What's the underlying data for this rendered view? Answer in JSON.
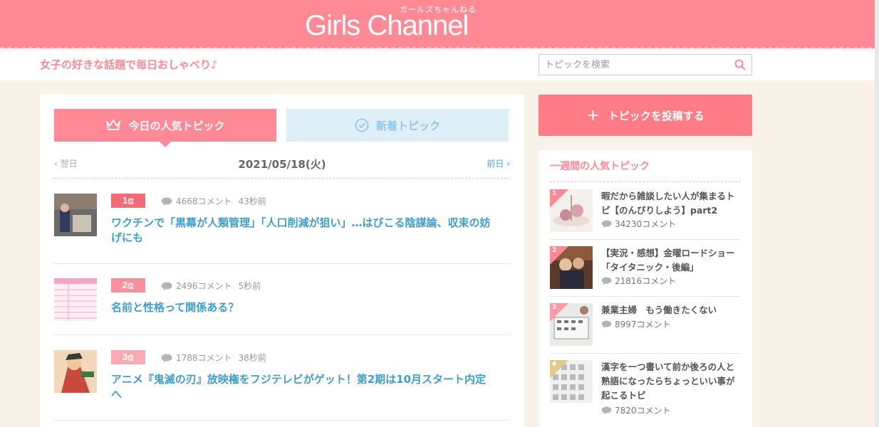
{
  "header": {
    "logo": "Girls Channel",
    "logo_sub": "ガールズちゃんねる",
    "tagline": "女子の好きな話題で毎日おしゃべり♪",
    "search_placeholder": "トピックを検索"
  },
  "tabs": {
    "popular": "今日の人気トピック",
    "new": "新着トピック"
  },
  "date_nav": {
    "next": "翌日",
    "date": "2021/05/18(火)",
    "prev": "前日"
  },
  "ranking": [
    {
      "rank": "1",
      "rank_suffix": "位",
      "comments": "4668コメント",
      "ago": "43秒前",
      "title": "ワクチンで「黒幕が人類管理」「人口削減が狙い」…はびこる陰謀論、収束の妨げにも"
    },
    {
      "rank": "2",
      "rank_suffix": "位",
      "comments": "2496コメント",
      "ago": "5秒前",
      "title": "名前と性格って関係ある？"
    },
    {
      "rank": "3",
      "rank_suffix": "位",
      "comments": "1788コメント",
      "ago": "38秒前",
      "title": "アニメ『鬼滅の刃』放映権をフジテレビがゲット！第2期は10月スタート内定へ"
    }
  ],
  "sidebar": {
    "post_button": "トピックを投稿する",
    "weekly_heading": "一週間の人気トピック",
    "weekly": [
      {
        "n": "1",
        "title": "暇だから雑談したい人が集まるトピ【のんびりしよう】part2",
        "comments": "34230コメント"
      },
      {
        "n": "2",
        "title": "【実況・感想】金曜ロードショー「タイタニック・後編」",
        "comments": "21816コメント"
      },
      {
        "n": "3",
        "title": "兼業主婦　もう働きたくない",
        "comments": "8997コメント"
      },
      {
        "n": "4",
        "title": "漢字を一つ書いて前か後ろの人と熟語になったらちょっといい事が起こるトピ",
        "comments": "7820コメント"
      }
    ]
  },
  "colors": {
    "brand_pink": "#ff8a95",
    "link_blue": "#3f9ecb",
    "rank1": "#f26b78",
    "rank2": "#f7919b",
    "rank3": "#f9aab2"
  }
}
